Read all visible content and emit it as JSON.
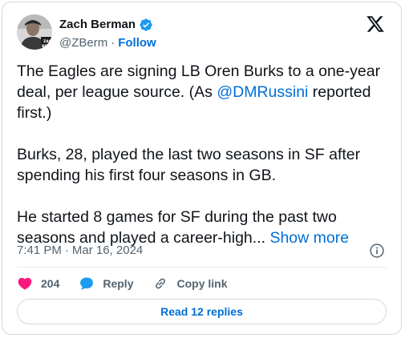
{
  "author": {
    "name": "Zach Berman",
    "handle": "@ZBerm",
    "separator": "·",
    "follow_label": "Follow",
    "avatar_caption": "ZAC BERM"
  },
  "tweet": {
    "paragraph1_before": "The Eagles are signing LB Oren Burks to a one-year deal, per league source. (As ",
    "paragraph1_mention": "@DMRussini",
    "paragraph1_after": " reported first.)",
    "paragraph2": "Burks, 28, played the last two seasons in SF after spending his first four seasons in GB.",
    "paragraph3": "He started 8 games for SF during the past two seasons and played a career-high... ",
    "show_more": "Show more"
  },
  "meta": {
    "time": "7:41 PM",
    "separator": "·",
    "date": "Mar 16, 2024"
  },
  "actions": {
    "like_count": "204",
    "reply_label": "Reply",
    "copy_link_label": "Copy link"
  },
  "read_replies_label": "Read 12 replies",
  "colors": {
    "accent": "#006fd6",
    "heart": "#f91880",
    "verified": "#1d9bf0",
    "muted": "#536471",
    "border": "#cfd9de"
  },
  "icons": {
    "verified": "verified-badge-icon",
    "logo": "x-logo-icon",
    "info": "info-icon",
    "like": "heart-icon",
    "reply": "speech-bubble-icon",
    "copy": "link-icon"
  }
}
